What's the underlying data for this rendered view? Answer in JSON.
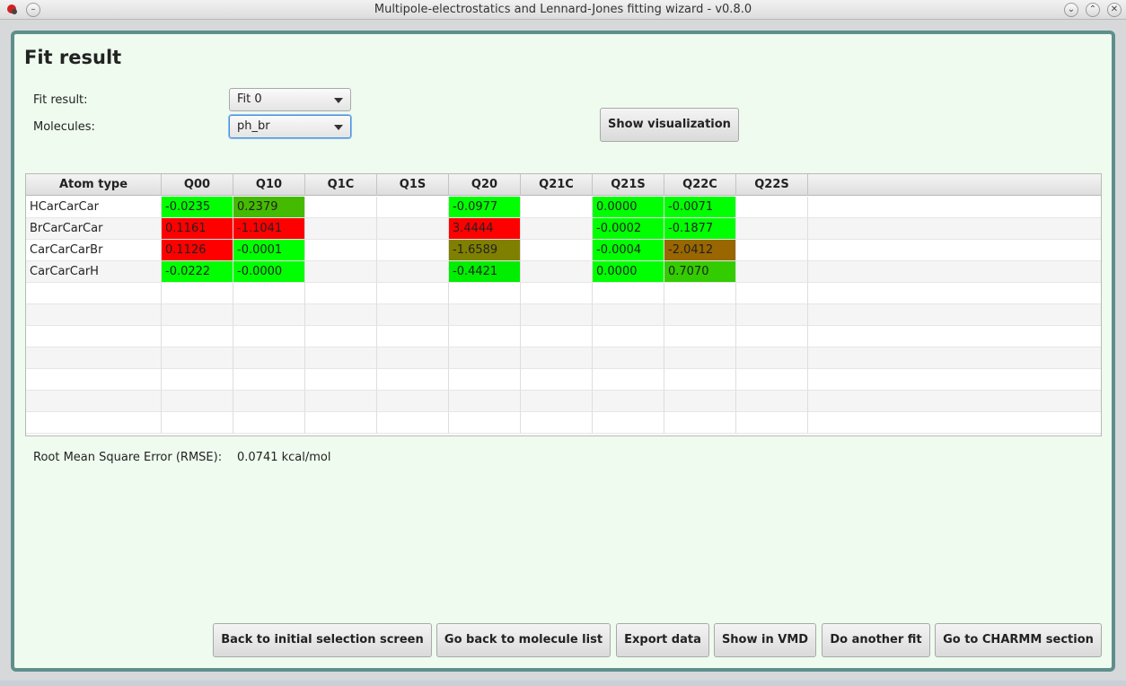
{
  "window": {
    "title": "Multipole-electrostatics and Lennard-Jones fitting wizard - v0.8.0"
  },
  "heading": "Fit result",
  "fit_result": {
    "label": "Fit result:",
    "value": "Fit 0"
  },
  "molecules": {
    "label": "Molecules:",
    "value": "ph_br"
  },
  "show_visualization": "Show visualization",
  "table": {
    "columns": [
      "Atom type",
      "Q00",
      "Q10",
      "Q1C",
      "Q1S",
      "Q20",
      "Q21C",
      "Q21S",
      "Q22C",
      "Q22S"
    ],
    "rows": [
      {
        "atom": "HCarCarCar",
        "cells": [
          {
            "v": "-0.0235",
            "bg": "#00ff00"
          },
          {
            "v": "0.2379",
            "bg": "#44bb00"
          },
          {
            "v": "",
            "bg": ""
          },
          {
            "v": "",
            "bg": ""
          },
          {
            "v": "-0.0977",
            "bg": "#00ff00"
          },
          {
            "v": "",
            "bg": ""
          },
          {
            "v": "0.0000",
            "bg": "#00ff00"
          },
          {
            "v": "-0.0071",
            "bg": "#00ff00"
          },
          {
            "v": "",
            "bg": ""
          }
        ]
      },
      {
        "atom": "BrCarCarCar",
        "cells": [
          {
            "v": "0.1161",
            "bg": "#ff0000"
          },
          {
            "v": "-1.1041",
            "bg": "#ff0000"
          },
          {
            "v": "",
            "bg": ""
          },
          {
            "v": "",
            "bg": ""
          },
          {
            "v": "3.4444",
            "bg": "#ff0000"
          },
          {
            "v": "",
            "bg": ""
          },
          {
            "v": "-0.0002",
            "bg": "#00ff00"
          },
          {
            "v": "-0.1877",
            "bg": "#00ff00"
          },
          {
            "v": "",
            "bg": ""
          }
        ]
      },
      {
        "atom": "CarCarCarBr",
        "cells": [
          {
            "v": "0.1126",
            "bg": "#ff0000"
          },
          {
            "v": "-0.0001",
            "bg": "#00ff00"
          },
          {
            "v": "",
            "bg": ""
          },
          {
            "v": "",
            "bg": ""
          },
          {
            "v": "-1.6589",
            "bg": "#808000"
          },
          {
            "v": "",
            "bg": ""
          },
          {
            "v": "-0.0004",
            "bg": "#00ff00"
          },
          {
            "v": "-2.0412",
            "bg": "#996600"
          },
          {
            "v": "",
            "bg": ""
          }
        ]
      },
      {
        "atom": "CarCarCarH",
        "cells": [
          {
            "v": "-0.0222",
            "bg": "#00ff00"
          },
          {
            "v": "-0.0000",
            "bg": "#00ff00"
          },
          {
            "v": "",
            "bg": ""
          },
          {
            "v": "",
            "bg": ""
          },
          {
            "v": "-0.4421",
            "bg": "#00ee00"
          },
          {
            "v": "",
            "bg": ""
          },
          {
            "v": "0.0000",
            "bg": "#00ff00"
          },
          {
            "v": "0.7070",
            "bg": "#33cc00"
          },
          {
            "v": "",
            "bg": ""
          }
        ]
      }
    ]
  },
  "rmse": {
    "label": "Root Mean Square Error (RMSE):",
    "value": "0.0741  kcal/mol"
  },
  "buttons": {
    "back_initial": "Back to initial selection screen",
    "back_molecules": "Go back to molecule list",
    "export": "Export data",
    "show_vmd": "Show in VMD",
    "another_fit": "Do another fit",
    "charmm": "Go to CHARMM section"
  },
  "colors": {
    "frame_border": "#5e8f8c",
    "background": "#eefbee",
    "good": "#00ff00",
    "bad": "#ff0000"
  }
}
